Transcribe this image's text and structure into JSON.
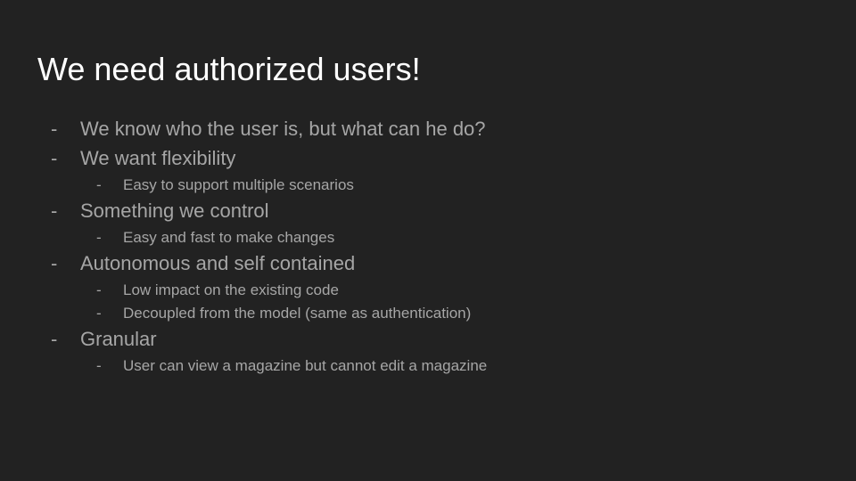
{
  "slide": {
    "title": "We need authorized users!",
    "bullet_marker": "-",
    "bullets": [
      {
        "text": "We know who the user is, but what can he do?"
      },
      {
        "text": "We want flexibility"
      },
      {
        "text": "Easy to support multiple scenarios"
      },
      {
        "text": "Something we control"
      },
      {
        "text": "Easy and fast to make changes"
      },
      {
        "text": "Autonomous and self contained"
      },
      {
        "text": "Low impact on the existing code"
      },
      {
        "text": "Decoupled from the model (same as authentication)"
      },
      {
        "text": "Granular"
      },
      {
        "text": "User can view a magazine but cannot edit a magazine"
      }
    ]
  },
  "colors": {
    "background": "#222222",
    "title": "#ffffff",
    "body_text": "#a6a6a6"
  }
}
